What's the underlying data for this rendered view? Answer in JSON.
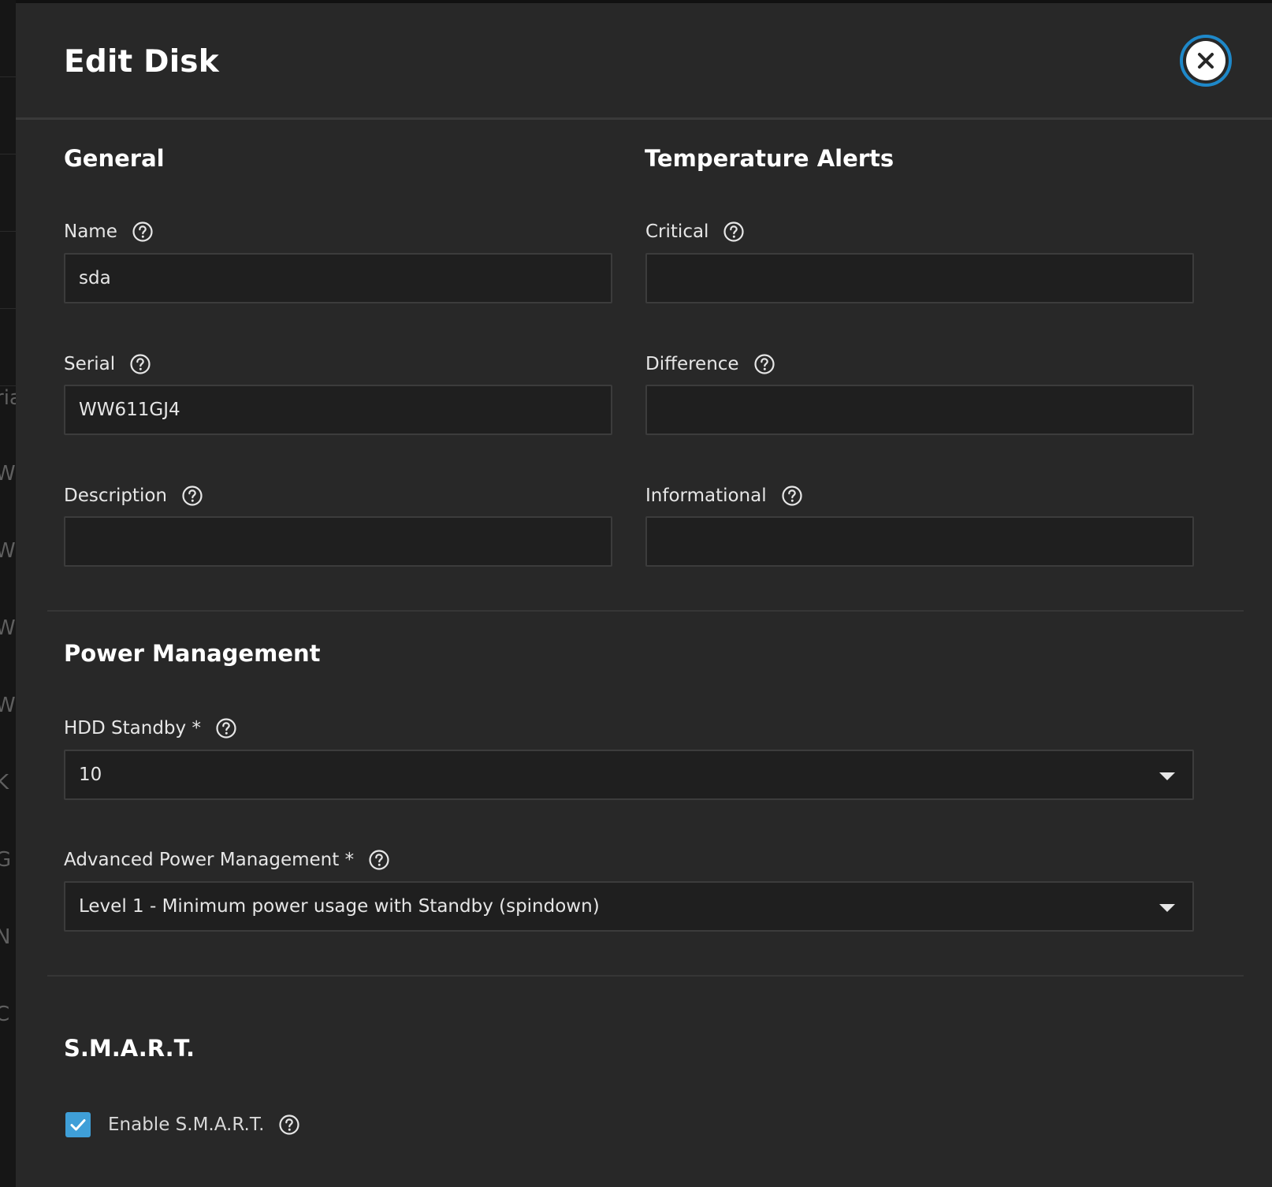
{
  "dialog": {
    "title": "Edit Disk"
  },
  "background_fragments": [
    "ria",
    "W",
    "W",
    "W",
    "W",
    "K",
    "G",
    "N",
    "C"
  ],
  "general": {
    "title": "General",
    "name": {
      "label": "Name",
      "value": "sda"
    },
    "serial": {
      "label": "Serial",
      "value": "WW611GJ4"
    },
    "description": {
      "label": "Description",
      "value": ""
    }
  },
  "temperature": {
    "title": "Temperature Alerts",
    "critical": {
      "label": "Critical",
      "value": ""
    },
    "difference": {
      "label": "Difference",
      "value": ""
    },
    "informational": {
      "label": "Informational",
      "value": ""
    }
  },
  "power": {
    "title": "Power Management",
    "hdd_standby": {
      "label": "HDD Standby *",
      "value": "10"
    },
    "apm": {
      "label": "Advanced Power Management *",
      "value": "Level 1 - Minimum power usage with Standby (spindown)"
    }
  },
  "smart": {
    "title": "S.M.A.R.T.",
    "enable": {
      "label": "Enable S.M.A.R.T.",
      "checked": true
    }
  },
  "colors": {
    "accent": "#1e88c9",
    "checkbox": "#3f9fd8",
    "panel": "#282828",
    "input": "#1f1f1f"
  }
}
